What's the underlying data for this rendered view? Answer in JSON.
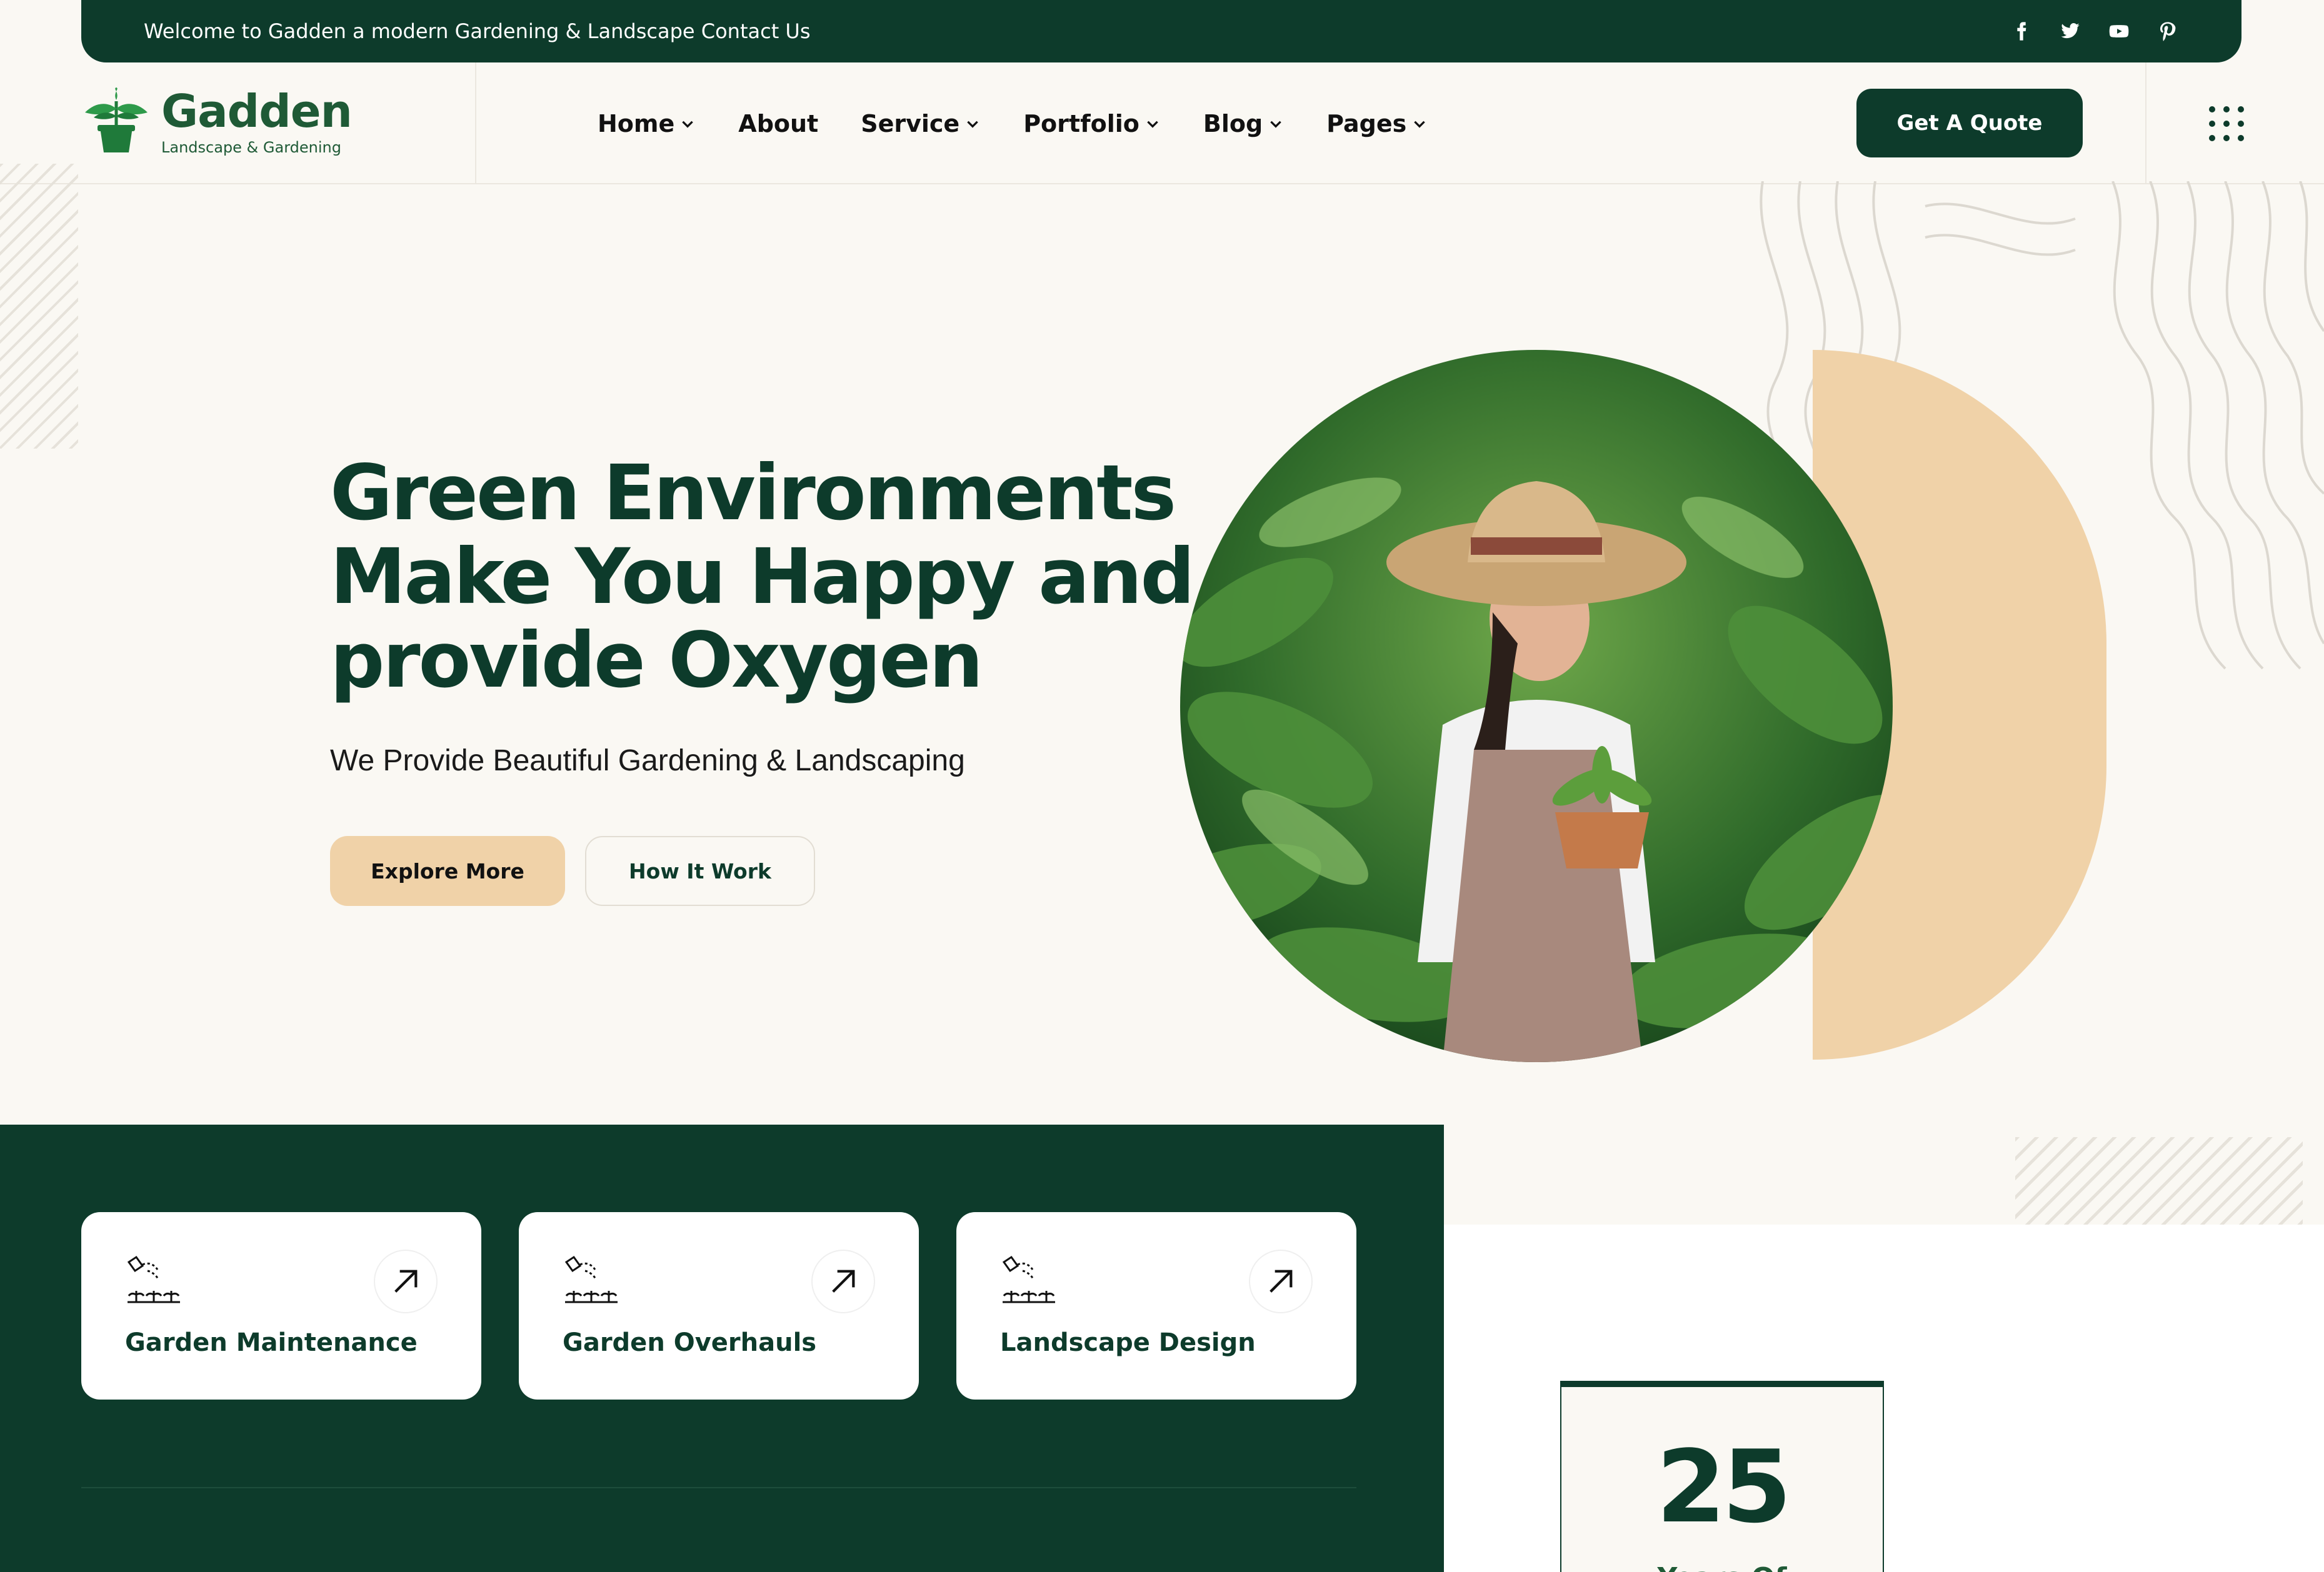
{
  "topbar": {
    "welcome": "Welcome to Gadden a modern Gardening & Landscape Contact Us",
    "social": [
      "facebook-icon",
      "twitter-icon",
      "youtube-icon",
      "pinterest-icon"
    ]
  },
  "brand": {
    "name": "Gadden",
    "tagline": "Landscape & Gardening"
  },
  "nav": {
    "items": [
      {
        "label": "Home",
        "dropdown": true
      },
      {
        "label": "About",
        "dropdown": false
      },
      {
        "label": "Service",
        "dropdown": true
      },
      {
        "label": "Portfolio",
        "dropdown": true
      },
      {
        "label": "Blog",
        "dropdown": true
      },
      {
        "label": "Pages",
        "dropdown": true
      }
    ],
    "cta": "Get A Quote"
  },
  "hero": {
    "title_lines": [
      "Green Environments",
      "Make You Happy and",
      "provide Oxygen"
    ],
    "subtitle": "We Provide Beautiful Gardening & Landscaping",
    "primary_button": "Explore More",
    "secondary_button": "How It Work"
  },
  "services": [
    {
      "title": "Garden Maintenance",
      "icon": "watering-can-icon"
    },
    {
      "title": "Garden Overhauls",
      "icon": "watering-can-icon"
    },
    {
      "title": "Landscape Design",
      "icon": "watering-can-icon"
    }
  ],
  "experience": {
    "number": "25",
    "label": "Years Of"
  },
  "colors": {
    "primary": "#0d3b2b",
    "accent": "#f0d2a8",
    "background": "#faf8f3"
  }
}
